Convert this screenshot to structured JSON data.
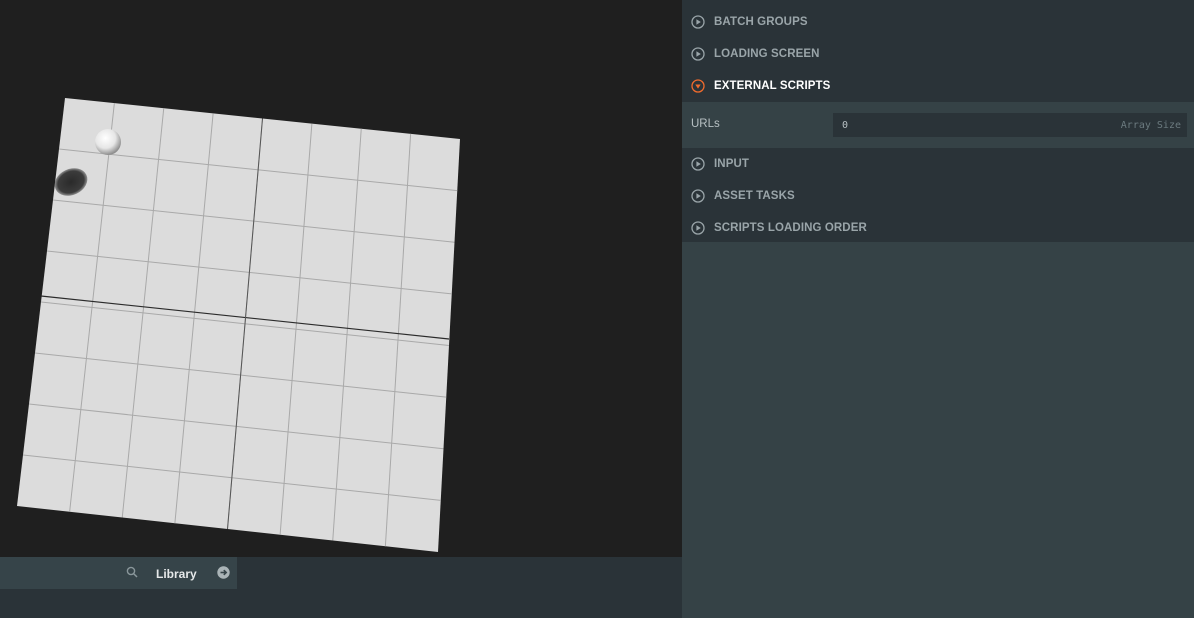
{
  "library": {
    "label": "Library",
    "search_icon": "search-icon",
    "expand_icon": "arrow-right-circle-icon"
  },
  "settings": {
    "sections": [
      {
        "label": "BATCH GROUPS",
        "expanded": false,
        "icon": "play-circle-icon"
      },
      {
        "label": "LOADING SCREEN",
        "expanded": false,
        "icon": "play-circle-icon"
      },
      {
        "label": "EXTERNAL SCRIPTS",
        "expanded": true,
        "icon": "chevron-down-circle-icon"
      },
      {
        "label": "INPUT",
        "expanded": false,
        "icon": "play-circle-icon"
      },
      {
        "label": "ASSET TASKS",
        "expanded": false,
        "icon": "play-circle-icon"
      },
      {
        "label": "SCRIPTS LOADING ORDER",
        "expanded": false,
        "icon": "play-circle-icon"
      }
    ],
    "external_scripts": {
      "urls_label": "URLs",
      "urls_value": "0",
      "urls_suffix": "Array Size"
    }
  },
  "colors": {
    "panel_bg": "#354246",
    "panel_dark": "#2a3338",
    "accent": "#f06b2d",
    "viewport_bg": "#1f1f1f",
    "plane": "#dcdcdc"
  }
}
